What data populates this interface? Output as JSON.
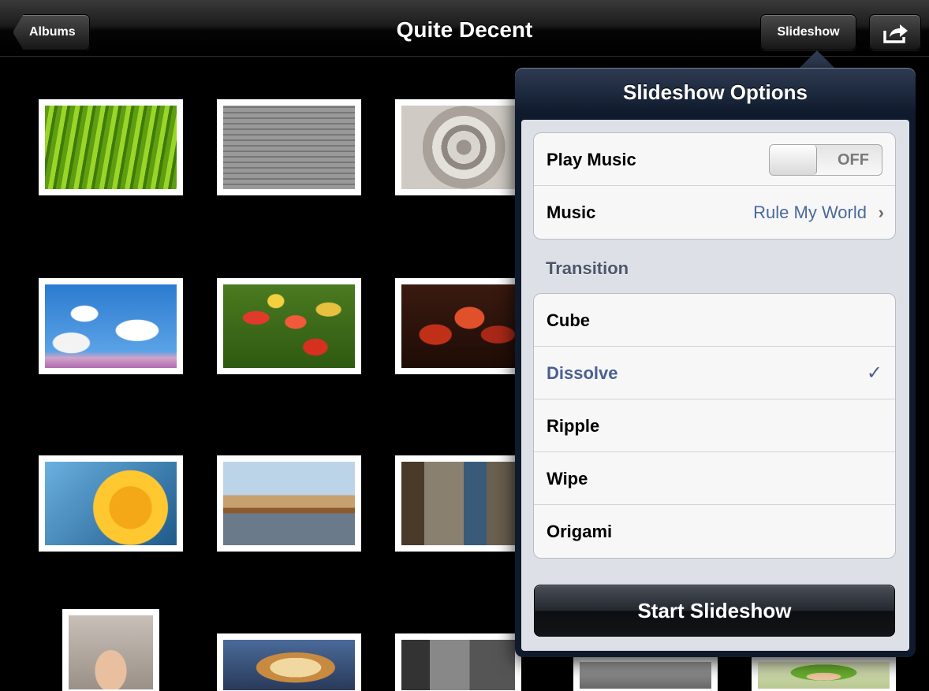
{
  "navbar": {
    "back_label": "Albums",
    "title": "Quite Decent",
    "slideshow_label": "Slideshow",
    "action_icon": "share-arrow-icon"
  },
  "popover": {
    "title": "Slideshow Options",
    "play_music_label": "Play Music",
    "play_music_state": "OFF",
    "music_label": "Music",
    "music_value": "Rule My World",
    "transition_header": "Transition",
    "transitions": [
      {
        "label": "Cube",
        "selected": false
      },
      {
        "label": "Dissolve",
        "selected": true
      },
      {
        "label": "Ripple",
        "selected": false
      },
      {
        "label": "Wipe",
        "selected": false
      },
      {
        "label": "Origami",
        "selected": false
      }
    ],
    "check_glyph": "✓",
    "chevron_glyph": "›",
    "start_label": "Start Slideshow"
  },
  "colors": {
    "selected_text": "#4a6090",
    "detail_text": "#4a6a9a",
    "popover_frame": "#0f1a2c"
  }
}
